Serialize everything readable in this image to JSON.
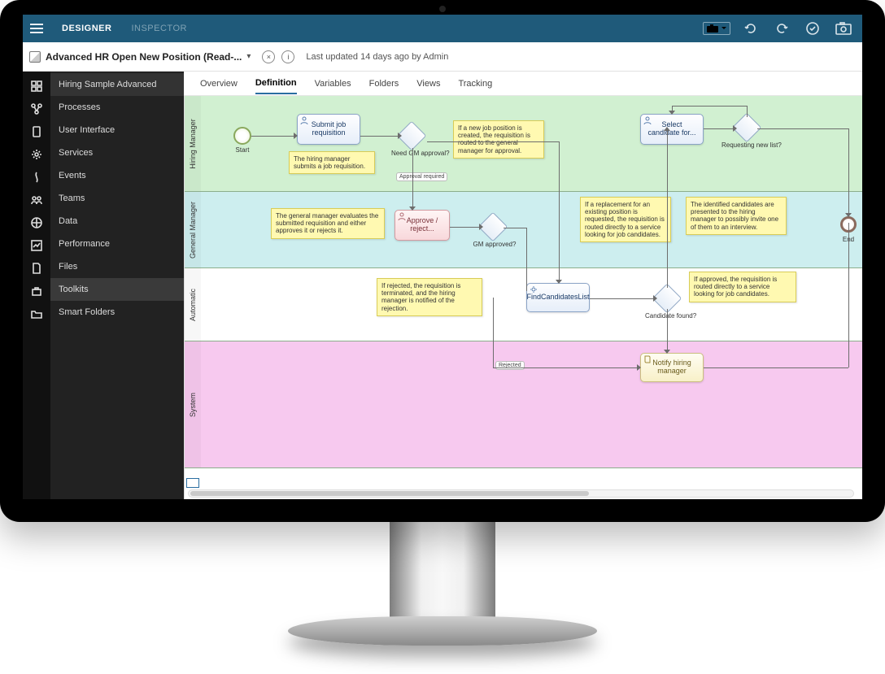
{
  "topnav": {
    "designer": "DESIGNER",
    "inspector": "INSPECTOR"
  },
  "title": {
    "name": "Advanced HR Open New Position (Read-...",
    "meta": "Last updated 14 days ago by Admin",
    "close_glyph": "×",
    "info_glyph": "i"
  },
  "sidebar": {
    "items": [
      "Hiring Sample Advanced",
      "Processes",
      "User Interface",
      "Services",
      "Events",
      "Teams",
      "Data",
      "Performance",
      "Files",
      "Toolkits",
      "Smart Folders"
    ],
    "active_index": 0,
    "selected_index": 9
  },
  "tabs": {
    "items": [
      "Overview",
      "Definition",
      "Variables",
      "Folders",
      "Views",
      "Tracking"
    ],
    "active_index": 1
  },
  "lanes": [
    "Hiring Manager",
    "General Manager",
    "Automatic",
    "System"
  ],
  "events": {
    "start": "Start",
    "end": "End"
  },
  "nodes": {
    "submit": "Submit job requisition",
    "select_candidate": "Select candidate for...",
    "approve": "Approve / reject...",
    "find": "FindCandidatesList",
    "notify": "Notify hiring manager"
  },
  "gateways": {
    "need_gm": "Need GM approval?",
    "req_new": "Requesting new list?",
    "gm_approved": "GM approved?",
    "cand_found": "Candidate found?"
  },
  "edge_labels": {
    "approval_required": "Approval required",
    "rejected": "Rejected"
  },
  "stickies": {
    "s1": "The hiring manager submits a job requisition.",
    "s2": "If a new job position is created, the requisition is routed to the general manager for approval.",
    "s3": "The general manager evaluates the submitted requisition and either approves it or rejects it.",
    "s4": "If a replacement for an existing position is requested, the requisition is routed directly to a service looking for job candidates.",
    "s5": "The identified candidates are presented to the hiring manager to possibly invite one of them to an interview.",
    "s6": "If rejected, the requisition is terminated, and the hiring manager is notified of the rejection.",
    "s7": "If approved, the requisition is routed directly to a service looking for job candidates."
  }
}
